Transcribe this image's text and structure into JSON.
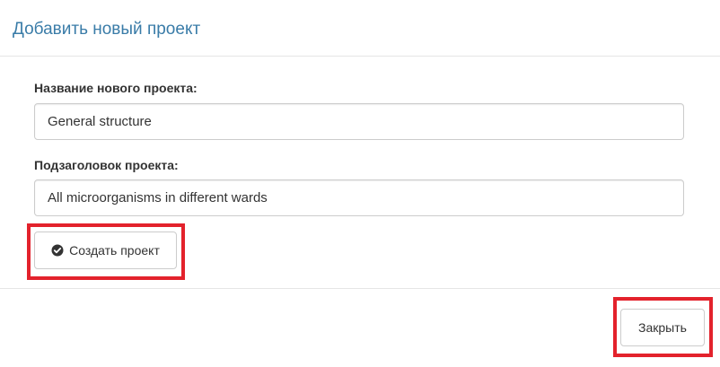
{
  "header": {
    "title": "Добавить новый проект"
  },
  "form": {
    "name_label": "Название нового проекта:",
    "name_value": "General structure",
    "subtitle_label": "Подзаголовок проекта:",
    "subtitle_value": "All microorganisms in different wards"
  },
  "actions": {
    "create_label": "Создать проект",
    "create_icon": "check-circle-icon",
    "close_label": "Закрыть"
  },
  "colors": {
    "title": "#3a7ca8",
    "highlight": "#e3222c"
  }
}
